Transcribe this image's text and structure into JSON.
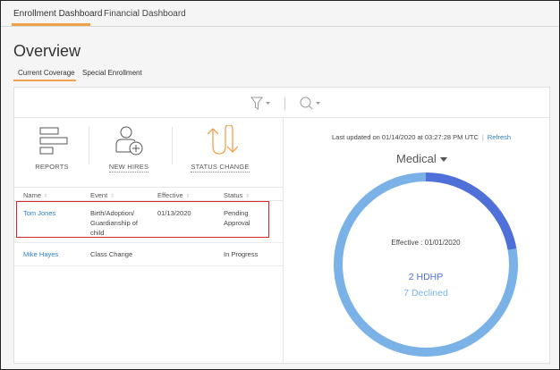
{
  "top_tabs": [
    {
      "label": "Enrollment Dashboard",
      "active": true
    },
    {
      "label": "Financial Dashboard",
      "active": false
    }
  ],
  "page_title": "Overview",
  "sub_tabs": [
    {
      "label": "Current Coverage",
      "active": true
    },
    {
      "label": "Special Enrollment",
      "active": false
    }
  ],
  "toolbar": {
    "filter_icon": "filter-icon",
    "search_icon": "search-icon"
  },
  "actions": [
    {
      "label": "REPORTS",
      "icon": "reports-icon"
    },
    {
      "label": "NEW HIRES",
      "icon": "new-hire-icon"
    },
    {
      "label": "STATUS CHANGE",
      "icon": "status-change-icon"
    }
  ],
  "table": {
    "headers": [
      "Name",
      "Event",
      "Effective",
      "Status"
    ],
    "rows": [
      {
        "name": "Tom Jones",
        "event": [
          "Birth/Adoption/",
          "Guardianship of",
          "child"
        ],
        "effective": "01/13/2020",
        "status": [
          "Pending",
          "Approval"
        ]
      },
      {
        "name": "Mike Hayes",
        "event": [
          "Class Change"
        ],
        "effective": "",
        "status": [
          "In Progress"
        ]
      }
    ]
  },
  "summary": {
    "updated_text": "Last updated on 01/14/2020 at 03:27:28 PM UTC",
    "separator": "|",
    "refresh_label": "Refresh",
    "plan_type": "Medical",
    "effective_label": "Effective : 01/01/2020",
    "counts": [
      {
        "label": "2 HDHP",
        "value": 2,
        "color": "#4f6fd9"
      },
      {
        "label": "7 Declined",
        "value": 7,
        "color": "#7ab2e8"
      }
    ]
  },
  "colors": {
    "accent": "#f0a24b",
    "link": "#2a7fc0",
    "highlight": "#d9252b"
  }
}
